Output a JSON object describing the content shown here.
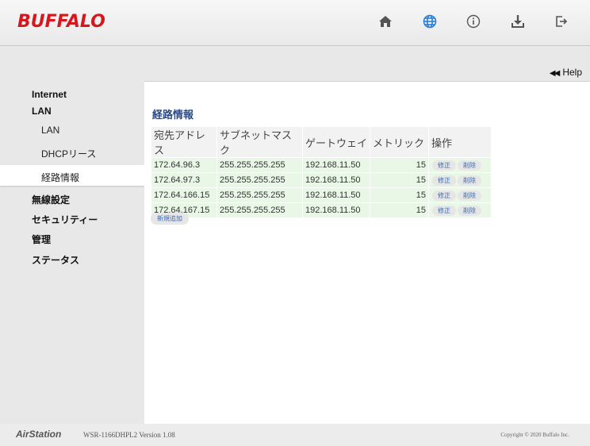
{
  "header": {
    "brand": "BUFFALO",
    "icons": [
      "home-icon",
      "globe-icon",
      "info-icon",
      "download-icon",
      "logout-icon"
    ]
  },
  "help": {
    "label": "Help"
  },
  "sidebar": {
    "items": [
      {
        "label": "Internet"
      },
      {
        "label": "LAN"
      },
      {
        "label": "LAN"
      },
      {
        "label": "DHCPリース"
      },
      {
        "label": "経路情報"
      },
      {
        "label": "無線設定"
      },
      {
        "label": "セキュリティー"
      },
      {
        "label": "管理"
      },
      {
        "label": "ステータス"
      }
    ]
  },
  "main": {
    "title": "経路情報",
    "table": {
      "headers": [
        "宛先アドレス",
        "サブネットマスク",
        "ゲートウェイ",
        "メトリック",
        "操作"
      ],
      "rows": [
        {
          "dest": "172.64.96.3",
          "mask": "255.255.255.255",
          "gateway": "192.168.11.50",
          "metric": "15",
          "edit": "修正",
          "delete": "削除"
        },
        {
          "dest": "172.64.97.3",
          "mask": "255.255.255.255",
          "gateway": "192.168.11.50",
          "metric": "15",
          "edit": "修正",
          "delete": "削除"
        },
        {
          "dest": "172.64.166.15",
          "mask": "255.255.255.255",
          "gateway": "192.168.11.50",
          "metric": "15",
          "edit": "修正",
          "delete": "削除"
        },
        {
          "dest": "172.64.167.15",
          "mask": "255.255.255.255",
          "gateway": "192.168.11.50",
          "metric": "15",
          "edit": "修正",
          "delete": "削除"
        }
      ]
    },
    "add_label": "新規追加"
  },
  "footer": {
    "product": "AirStation",
    "model": "WSR-1166DHPL2 Version 1.08",
    "copyright": "Copyright © 2020 Buffalo Inc."
  },
  "colors": {
    "brand": "#d6171e",
    "title": "#2c4a86",
    "row_bg": "#e9f7e7",
    "active_icon": "#2a7fd4"
  }
}
